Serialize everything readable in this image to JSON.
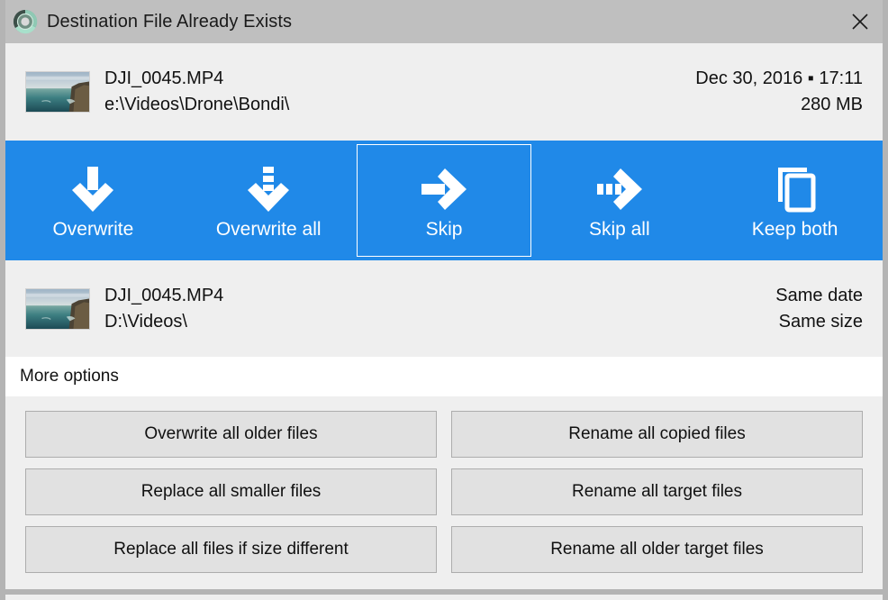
{
  "window": {
    "title": "Destination File Already Exists",
    "icon": "app-disc-icon",
    "close_label": "✕",
    "accent_color": "#2089e8",
    "titlebar_color": "#bfbfbf",
    "body_color": "#efefef"
  },
  "source_file": {
    "name": "DJI_0045.MP4",
    "path": "e:\\Videos\\Drone\\Bondi\\",
    "date": "Dec 30, 2016 ▪ 17:11",
    "size": "280 MB",
    "thumbnail": "coastline-photo-thumbnail"
  },
  "target_file": {
    "name": "DJI_0045.MP4",
    "path": "D:\\Videos\\",
    "date": "Same date",
    "size": "Same size",
    "thumbnail": "coastline-photo-thumbnail"
  },
  "actions": [
    {
      "id": "overwrite",
      "label": "Overwrite",
      "icon": "arrow-down-icon",
      "focused": false
    },
    {
      "id": "overwrite-all",
      "label": "Overwrite all",
      "icon": "arrow-down-dashed-icon",
      "focused": false
    },
    {
      "id": "skip",
      "label": "Skip",
      "icon": "arrow-right-icon",
      "focused": true
    },
    {
      "id": "skip-all",
      "label": "Skip all",
      "icon": "arrow-right-dashed-icon",
      "focused": false
    },
    {
      "id": "keep-both",
      "label": "Keep both",
      "icon": "copy-files-icon",
      "focused": false
    }
  ],
  "more_options": {
    "label": "More options",
    "buttons": [
      {
        "id": "overwrite-all-older-files",
        "label": "Overwrite all older files"
      },
      {
        "id": "rename-all-copied-files",
        "label": "Rename all copied files"
      },
      {
        "id": "replace-all-smaller-files",
        "label": "Replace all smaller files"
      },
      {
        "id": "rename-all-target-files",
        "label": "Rename all target files"
      },
      {
        "id": "replace-all-files-if-size-different",
        "label": "Replace all files if size different"
      },
      {
        "id": "rename-all-older-target-files",
        "label": "Rename all older target files"
      }
    ]
  }
}
